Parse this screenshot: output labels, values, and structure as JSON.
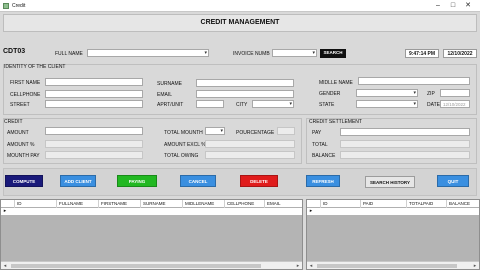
{
  "window": {
    "title": "Credit",
    "icon": "app-icon",
    "controls": [
      "minimize-icon",
      "maximize-icon",
      "close-icon"
    ]
  },
  "header": {
    "title": "CREDIT MANAGEMENT"
  },
  "top": {
    "code": "CDT03",
    "fullname_label": "FULL NAME",
    "invoice_label": "INVOICE NUMB",
    "search_label": "SEARCH",
    "time": "9:47:14 PM",
    "date": "12/10/2022"
  },
  "identity": {
    "title": "IDENTITY OF THE CLIENT",
    "first_name": "FIRST NAME",
    "cellphone": "CELLPHONE",
    "street": "STREET",
    "surname": "SURNAME",
    "email": "EMAIL",
    "apart_unit": "APRT/UNIT",
    "city": "CITY",
    "middle_name": "MIDLLE NAME",
    "gender": "GENDER",
    "zip": "ZIP",
    "state": "STATE",
    "date_label": "DATE",
    "date_value": "12/10/2022"
  },
  "credit": {
    "title": "CREDIT",
    "amount": "AMOUNT",
    "amount_pct": "AMOUNT %",
    "mounth_pay": "MOUNTH PAY",
    "total_mounth": "TOTAL MOUNTH",
    "pourcentage": "POURCENTAGE",
    "amount_excl": "AMOUNT EXCL %",
    "total_owing": "TOTAL OWING"
  },
  "settlement": {
    "title": "CREDIT SETTLEMENT",
    "pay": "PAY",
    "total": "TOTAL",
    "balance": "BALANCE"
  },
  "buttons": {
    "compute": "COMPUTE",
    "add_client": "ADD CLIENT",
    "paying": "PAYING",
    "cancel": "CANCEL",
    "delete": "DELETE",
    "refresh": "REFRESH",
    "search_history": "SEARCH HISTORY",
    "quit": "QUIT"
  },
  "colors": {
    "compute": "#1a1a7a",
    "add_client": "#3a8fe0",
    "paying": "#22b822",
    "cancel": "#3a8fe0",
    "delete": "#e01c1c",
    "refresh": "#3a8fe0",
    "search_history": "#e6e6e6",
    "quit": "#3a8fe0"
  },
  "grid_left": {
    "columns": [
      "ID",
      "FULLNAME",
      "FIRSTNAME",
      "SURNAME",
      "MIDLLENAME",
      "CELLPHONE",
      "EMAIL"
    ]
  },
  "grid_right": {
    "columns": [
      "ID",
      "PAID",
      "TOTALPAID",
      "BALANCE"
    ]
  }
}
